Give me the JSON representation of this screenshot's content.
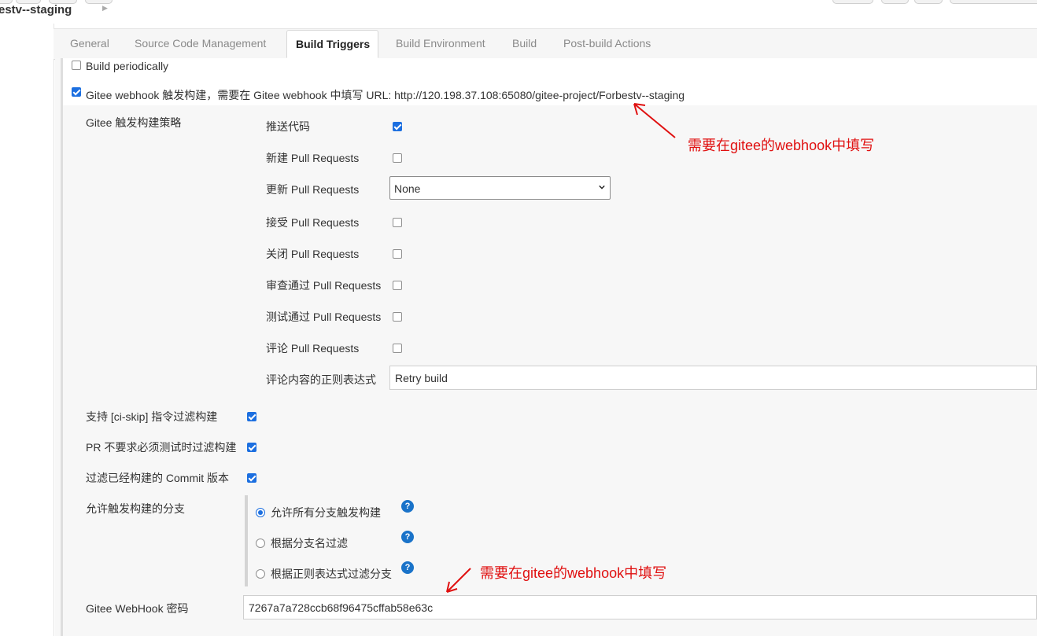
{
  "header": {
    "title": "estv--staging"
  },
  "tabs": [
    "General",
    "Source Code Management",
    "Build Triggers",
    "Build Environment",
    "Build",
    "Post-build Actions"
  ],
  "active_tab": "Build Triggers",
  "triggers": {
    "build_periodically": {
      "label": "Build periodically",
      "checked": false
    },
    "gitee_webhook": {
      "label": "Gitee webhook 触发构建，需要在 Gitee webhook 中填写 URL: http://120.198.37.108:65080/gitee-project/Forbestv--staging",
      "checked": true
    }
  },
  "strategy": {
    "title": "Gitee 触发构建策略",
    "push_code": {
      "label": "推送代码",
      "checked": true
    },
    "new_pr": {
      "label": "新建 Pull Requests",
      "checked": false
    },
    "update_pr": {
      "label": "更新 Pull Requests",
      "value": "None"
    },
    "accept_pr": {
      "label": "接受 Pull Requests",
      "checked": false
    },
    "close_pr": {
      "label": "关闭 Pull Requests",
      "checked": false
    },
    "approve_pr": {
      "label": "审查通过 Pull Requests",
      "checked": false
    },
    "test_pr": {
      "label": "测试通过 Pull Requests",
      "checked": false
    },
    "comment_pr": {
      "label": "评论 Pull Requests",
      "checked": false
    },
    "comment_regex": {
      "label": "评论内容的正则表达式",
      "value": "Retry build"
    }
  },
  "options": {
    "ci_skip": {
      "label": "支持 [ci-skip] 指令过滤构建",
      "checked": true
    },
    "pr_no_test": {
      "label": "PR 不要求必须测试时过滤构建",
      "checked": true
    },
    "filter_built": {
      "label": "过滤已经构建的 Commit 版本",
      "checked": true
    }
  },
  "branches": {
    "label": "允许触发构建的分支",
    "all": "允许所有分支触发构建",
    "by_name": "根据分支名过滤",
    "by_regex": "根据正则表达式过滤分支",
    "selected": "all",
    "help_icon": "?"
  },
  "webhook_secret": {
    "label": "Gitee WebHook 密码",
    "value": "7267a7a728ccb68f96475cffab58e63c"
  },
  "annotations": {
    "note_1": "需要在gitee的webhook中填写",
    "note_2": "需要在gitee的webhook中填写",
    "color": "#e01010"
  },
  "colors": {
    "accent": "#1c6fe0",
    "help": "#1a73c9"
  }
}
